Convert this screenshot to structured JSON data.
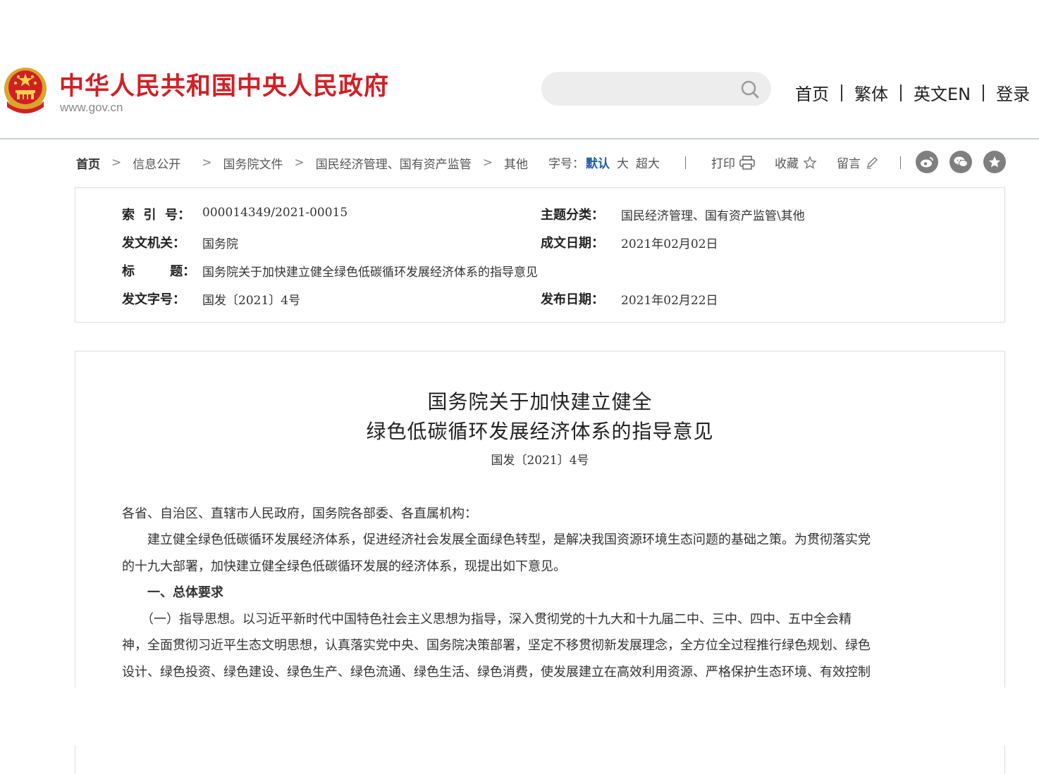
{
  "header": {
    "site_title": "中华人民共和国中央人民政府",
    "site_domain": "www.gov.cn",
    "search_placeholder": "",
    "nav": [
      {
        "label": "首页"
      },
      {
        "label": "繁体"
      },
      {
        "label": "英文EN"
      },
      {
        "label": "登录"
      }
    ],
    "title_color": "#d21f24"
  },
  "breadcrumb": {
    "items": [
      "首页",
      "信息公开",
      "国务院文件",
      "国民经济管理、国有资产监管",
      "其他"
    ]
  },
  "font_size": {
    "label": "字号：",
    "active": "默认",
    "options": [
      "大",
      "超大"
    ]
  },
  "tools": {
    "print": "打印",
    "favorite": "收藏",
    "comment": "留言"
  },
  "share_icons": [
    "weibo-icon",
    "wechat-icon",
    "star-share-icon"
  ],
  "info": {
    "index_label": "索  引  号：",
    "index_value": "000014349/2021-00015",
    "topic_label": "主题分类：",
    "topic_value": "国民经济管理、国有资产监管\\其他",
    "issuer_label": "发文机关：",
    "issuer_value": "国务院",
    "created_label": "成文日期：",
    "created_value": "2021年02月02日",
    "title_label": "标        题：",
    "title_value": "国务院关于加快建立健全绿色低碳循环发展经济体系的指导意见",
    "docno_label": "发文字号：",
    "docno_value": "国发〔2021〕4号",
    "published_label": "发布日期：",
    "published_value": "2021年02月22日"
  },
  "article": {
    "title_line1": "国务院关于加快建立健全",
    "title_line2": "绿色低碳循环发展经济体系的指导意见",
    "doc_number": "国发〔2021〕4号",
    "salutation": "各省、自治区、直辖市人民政府，国务院各部委、各直属机构：",
    "para1_line1": "　　建立健全绿色低碳循环发展经济体系，促进经济社会发展全面绿色转型，是解决我国资源环境生态问题的基础之策。为贯彻落实党",
    "para1_line2": "的十九大部署，加快建立健全绿色低碳循环发展的经济体系，现提出如下意见。",
    "section1": "　　一、总体要求",
    "para2_line1": "　　（一）指导思想。以习近平新时代中国特色社会主义思想为指导，深入贯彻党的十九大和十九届二中、三中、四中、五中全会精",
    "para2_line2": "神，全面贯彻习近平生态文明思想，认真落实党中央、国务院决策部署，坚定不移贯彻新发展理念，全方位全过程推行绿色规划、绿色",
    "para2_line3": "设计、绿色投资、绿色建设、绿色生产、绿色流通、绿色生活、绿色消费，使发展建立在高效利用资源、严格保护生态环境、有效控制"
  }
}
